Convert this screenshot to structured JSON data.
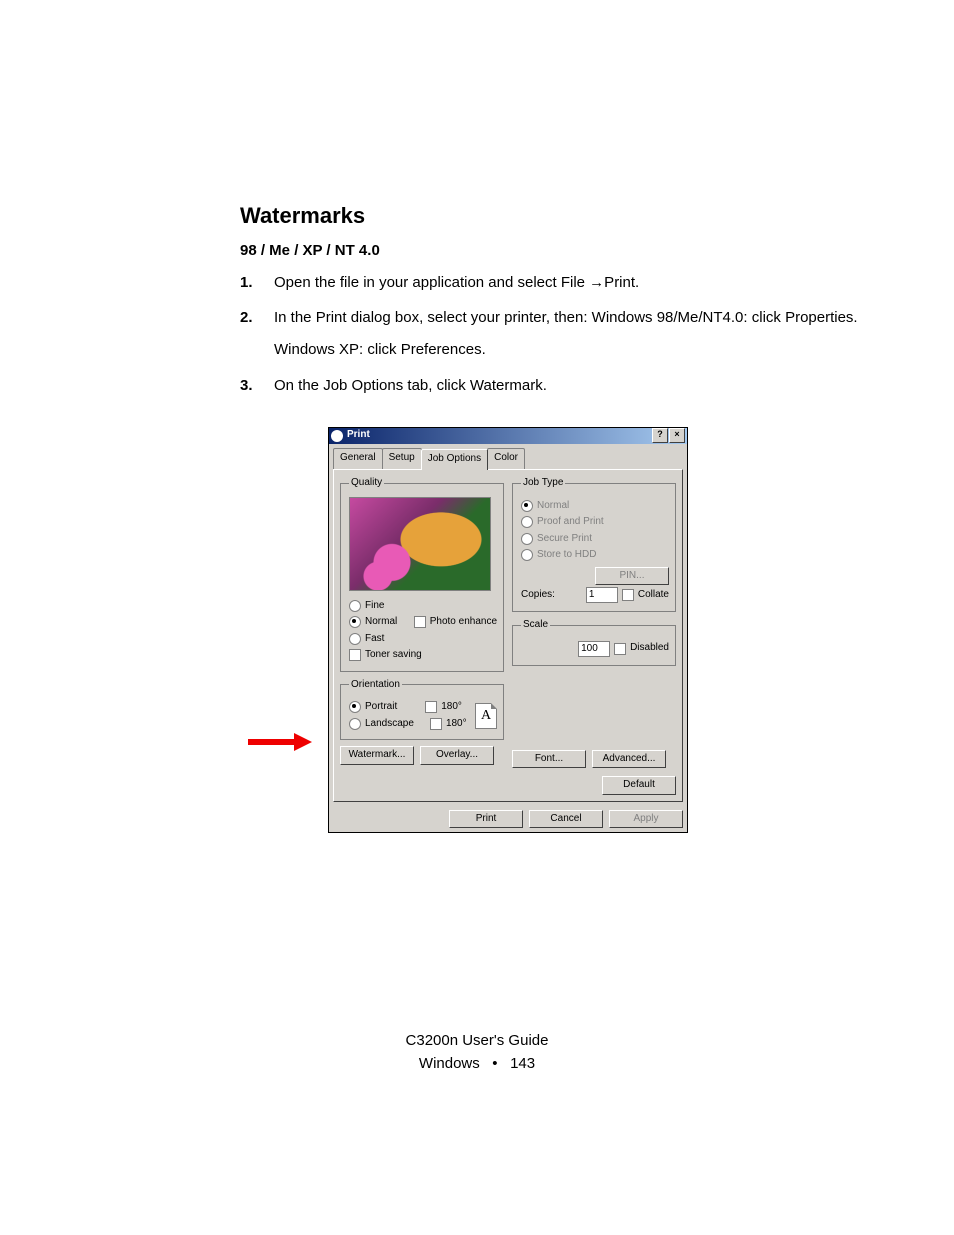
{
  "heading": "Watermarks",
  "subheading": "98 / Me / XP / NT 4.0",
  "steps": [
    {
      "num": "1.",
      "paras": [
        "Open the file in your application and select File →Print."
      ]
    },
    {
      "num": "2.",
      "paras": [
        "In the Print dialog box, select your printer, then: Windows 98/Me/NT4.0: click Properties.",
        "Windows XP: click Preferences."
      ]
    },
    {
      "num": "3.",
      "paras": [
        "On the Job Options tab, click Watermark."
      ]
    }
  ],
  "dialog": {
    "title": "Print",
    "help_btn": "?",
    "close_btn": "×",
    "tabs": [
      "General",
      "Setup",
      "Job Options",
      "Color"
    ],
    "active_tab": "Job Options",
    "quality": {
      "legend": "Quality",
      "fine": "Fine",
      "normal": "Normal",
      "fast": "Fast",
      "photo_enhance": "Photo enhance",
      "toner_saving": "Toner saving"
    },
    "orientation": {
      "legend": "Orientation",
      "portrait": "Portrait",
      "landscape": "Landscape",
      "r180a": "180°",
      "r180b": "180°",
      "page_letter": "A"
    },
    "jobtype": {
      "legend": "Job Type",
      "normal": "Normal",
      "proof": "Proof and Print",
      "secure": "Secure Print",
      "store": "Store to HDD",
      "pin": "PIN...",
      "copies_label": "Copies:",
      "copies_value": "1",
      "collate": "Collate"
    },
    "scale": {
      "legend": "Scale",
      "value": "100",
      "disabled": "Disabled"
    },
    "buttons": {
      "watermark": "Watermark...",
      "overlay": "Overlay...",
      "font": "Font...",
      "advanced": "Advanced...",
      "default": "Default",
      "print": "Print",
      "cancel": "Cancel",
      "apply": "Apply"
    }
  },
  "footer": {
    "line1": "C3200n User's Guide",
    "line2_a": "Windows",
    "bullet": "•",
    "page": "143"
  }
}
